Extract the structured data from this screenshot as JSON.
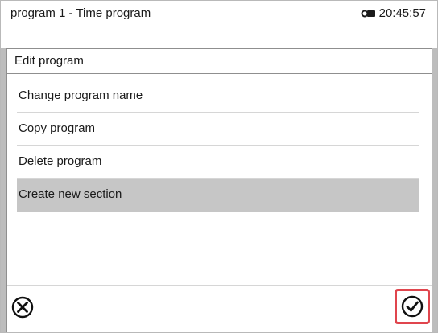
{
  "header": {
    "title": "program 1 - Time program",
    "time": "20:45:57",
    "lock_icon": "key-icon"
  },
  "dialog": {
    "title": "Edit program",
    "items": [
      {
        "label": "Change program name",
        "selected": false
      },
      {
        "label": "Copy program",
        "selected": false
      },
      {
        "label": "Delete program",
        "selected": false
      },
      {
        "label": "Create new section",
        "selected": true
      }
    ],
    "cancel_icon": "cancel-x-icon",
    "confirm_icon": "confirm-check-icon"
  },
  "colors": {
    "selected_bg": "#c6c6c6",
    "highlight_border": "#e0454d",
    "overlay_gray": "#bdbdbd"
  }
}
